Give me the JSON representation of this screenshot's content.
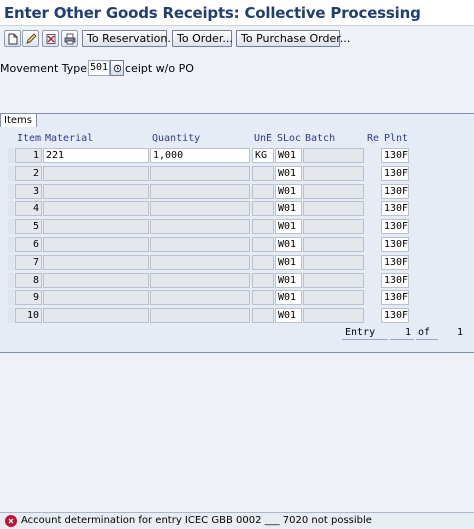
{
  "window": {
    "title": "Enter Other Goods Receipts: Collective Processing"
  },
  "toolbar": {
    "icons": [
      "new-document-icon",
      "edit-icon",
      "delete-icon",
      "print-icon"
    ],
    "buttons": [
      "To Reservation...",
      "To Order...",
      "To Purchase Order..."
    ]
  },
  "header": {
    "movement_type_label": "Movement Type",
    "movement_type_value": "501",
    "movement_type_text": "ceipt w/o PO"
  },
  "items": {
    "tab_label": "Items",
    "columns": [
      "Item",
      "Material",
      "Quantity",
      "UnE",
      "SLoc",
      "Batch",
      "Re",
      "Plnt"
    ],
    "rows": [
      {
        "item": "1",
        "material": "221",
        "quantity": "1,000",
        "unit": "KG",
        "sloc": "W01",
        "batch": "",
        "plant": "130F"
      },
      {
        "item": "2",
        "material": "",
        "quantity": "",
        "unit": "",
        "sloc": "W01",
        "batch": "",
        "plant": "130F"
      },
      {
        "item": "3",
        "material": "",
        "quantity": "",
        "unit": "",
        "sloc": "W01",
        "batch": "",
        "plant": "130F"
      },
      {
        "item": "4",
        "material": "",
        "quantity": "",
        "unit": "",
        "sloc": "W01",
        "batch": "",
        "plant": "130F"
      },
      {
        "item": "5",
        "material": "",
        "quantity": "",
        "unit": "",
        "sloc": "W01",
        "batch": "",
        "plant": "130F"
      },
      {
        "item": "6",
        "material": "",
        "quantity": "",
        "unit": "",
        "sloc": "W01",
        "batch": "",
        "plant": "130F"
      },
      {
        "item": "7",
        "material": "",
        "quantity": "",
        "unit": "",
        "sloc": "W01",
        "batch": "",
        "plant": "130F"
      },
      {
        "item": "8",
        "material": "",
        "quantity": "",
        "unit": "",
        "sloc": "W01",
        "batch": "",
        "plant": "130F"
      },
      {
        "item": "9",
        "material": "",
        "quantity": "",
        "unit": "",
        "sloc": "W01",
        "batch": "",
        "plant": "130F"
      },
      {
        "item": "10",
        "material": "",
        "quantity": "",
        "unit": "",
        "sloc": "W01",
        "batch": "",
        "plant": "130F"
      }
    ],
    "pager": {
      "entry_label": "Entry",
      "current": "1",
      "of_label": "of",
      "total": "1"
    }
  },
  "status": {
    "icon": "error-icon",
    "message": "Account determination for entry ICEC GBB 0002 ___ 7020 not possible",
    "color": "#c8102e"
  }
}
